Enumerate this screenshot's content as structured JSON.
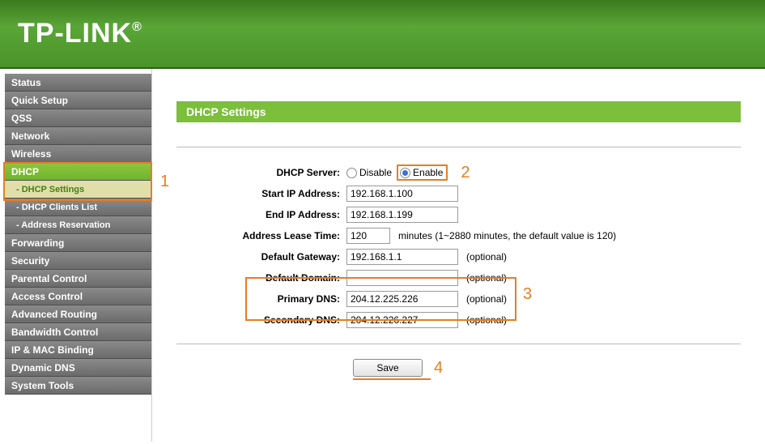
{
  "brand": "TP-LINK",
  "sidebar": {
    "items": [
      {
        "label": "Status"
      },
      {
        "label": "Quick Setup"
      },
      {
        "label": "QSS"
      },
      {
        "label": "Network"
      },
      {
        "label": "Wireless"
      },
      {
        "label": "DHCP",
        "active_parent": true
      },
      {
        "label": "Forwarding"
      },
      {
        "label": "Security"
      },
      {
        "label": "Parental Control"
      },
      {
        "label": "Access Control"
      },
      {
        "label": "Advanced Routing"
      },
      {
        "label": "Bandwidth Control"
      },
      {
        "label": "IP & MAC Binding"
      },
      {
        "label": "Dynamic DNS"
      },
      {
        "label": "System Tools"
      }
    ],
    "subitems": [
      {
        "label": "- DHCP Settings",
        "active": true
      },
      {
        "label": "- DHCP Clients List"
      },
      {
        "label": "- Address Reservation"
      }
    ]
  },
  "page": {
    "title": "DHCP Settings",
    "rows": {
      "dhcp_server_label": "DHCP Server:",
      "disable": "Disable",
      "enable": "Enable",
      "start_ip_label": "Start IP Address:",
      "start_ip": "192.168.1.100",
      "end_ip_label": "End IP Address:",
      "end_ip": "192.168.1.199",
      "lease_label": "Address Lease Time:",
      "lease": "120",
      "lease_hint": "minutes (1~2880 minutes, the default value is 120)",
      "gateway_label": "Default Gateway:",
      "gateway": "192.168.1.1",
      "optional": "(optional)",
      "domain_label": "Default Domain:",
      "domain": "",
      "pdns_label": "Primary DNS:",
      "pdns": "204.12.225.226",
      "sdns_label": "Secondary DNS:",
      "sdns": "204.12.226.227"
    },
    "save": "Save"
  },
  "annotations": {
    "a1": "1",
    "a2": "2",
    "a3": "3",
    "a4": "4"
  }
}
